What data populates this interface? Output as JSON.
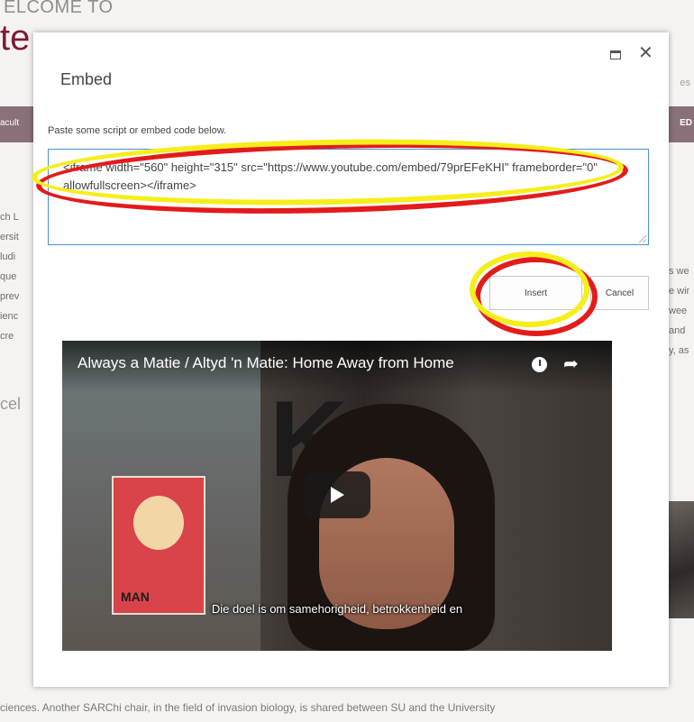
{
  "background": {
    "welcome_fragment": "ELCOME TO",
    "title_fragment": "te",
    "band_left": "acult",
    "band_right": "ED",
    "search_fragment": "es",
    "section_heading_fragment": "cel",
    "left_col": [
      "ch L",
      "",
      "ersit",
      "ludi",
      "que",
      "prev",
      "ienc",
      " cre"
    ],
    "right_col": [
      "s we",
      "e wir",
      "wee",
      "and",
      "y, as"
    ],
    "bottom_text": "ciences. Another SARChi chair, in the field of invasion biology, is shared between SU and the University"
  },
  "dialog": {
    "title": "Embed",
    "instruction": "Paste some script or embed code below.",
    "embed_code": "<iframe width=\"560\" height=\"315\" src=\"https://www.youtube.com/embed/79prEFeKHI\" frameborder=\"0\" allowfullscreen></iframe>",
    "insert_label": "Insert",
    "cancel_label": "Cancel"
  },
  "video": {
    "title": "Always a Matie / Altyd 'n Matie: Home Away from Home",
    "caption": "Die doel is om samehorigheid, betrokkenheid en",
    "poster_text": "MAN"
  },
  "annotations": {
    "highlight_colors": [
      "#e31b1b",
      "#f6ee1a"
    ]
  }
}
